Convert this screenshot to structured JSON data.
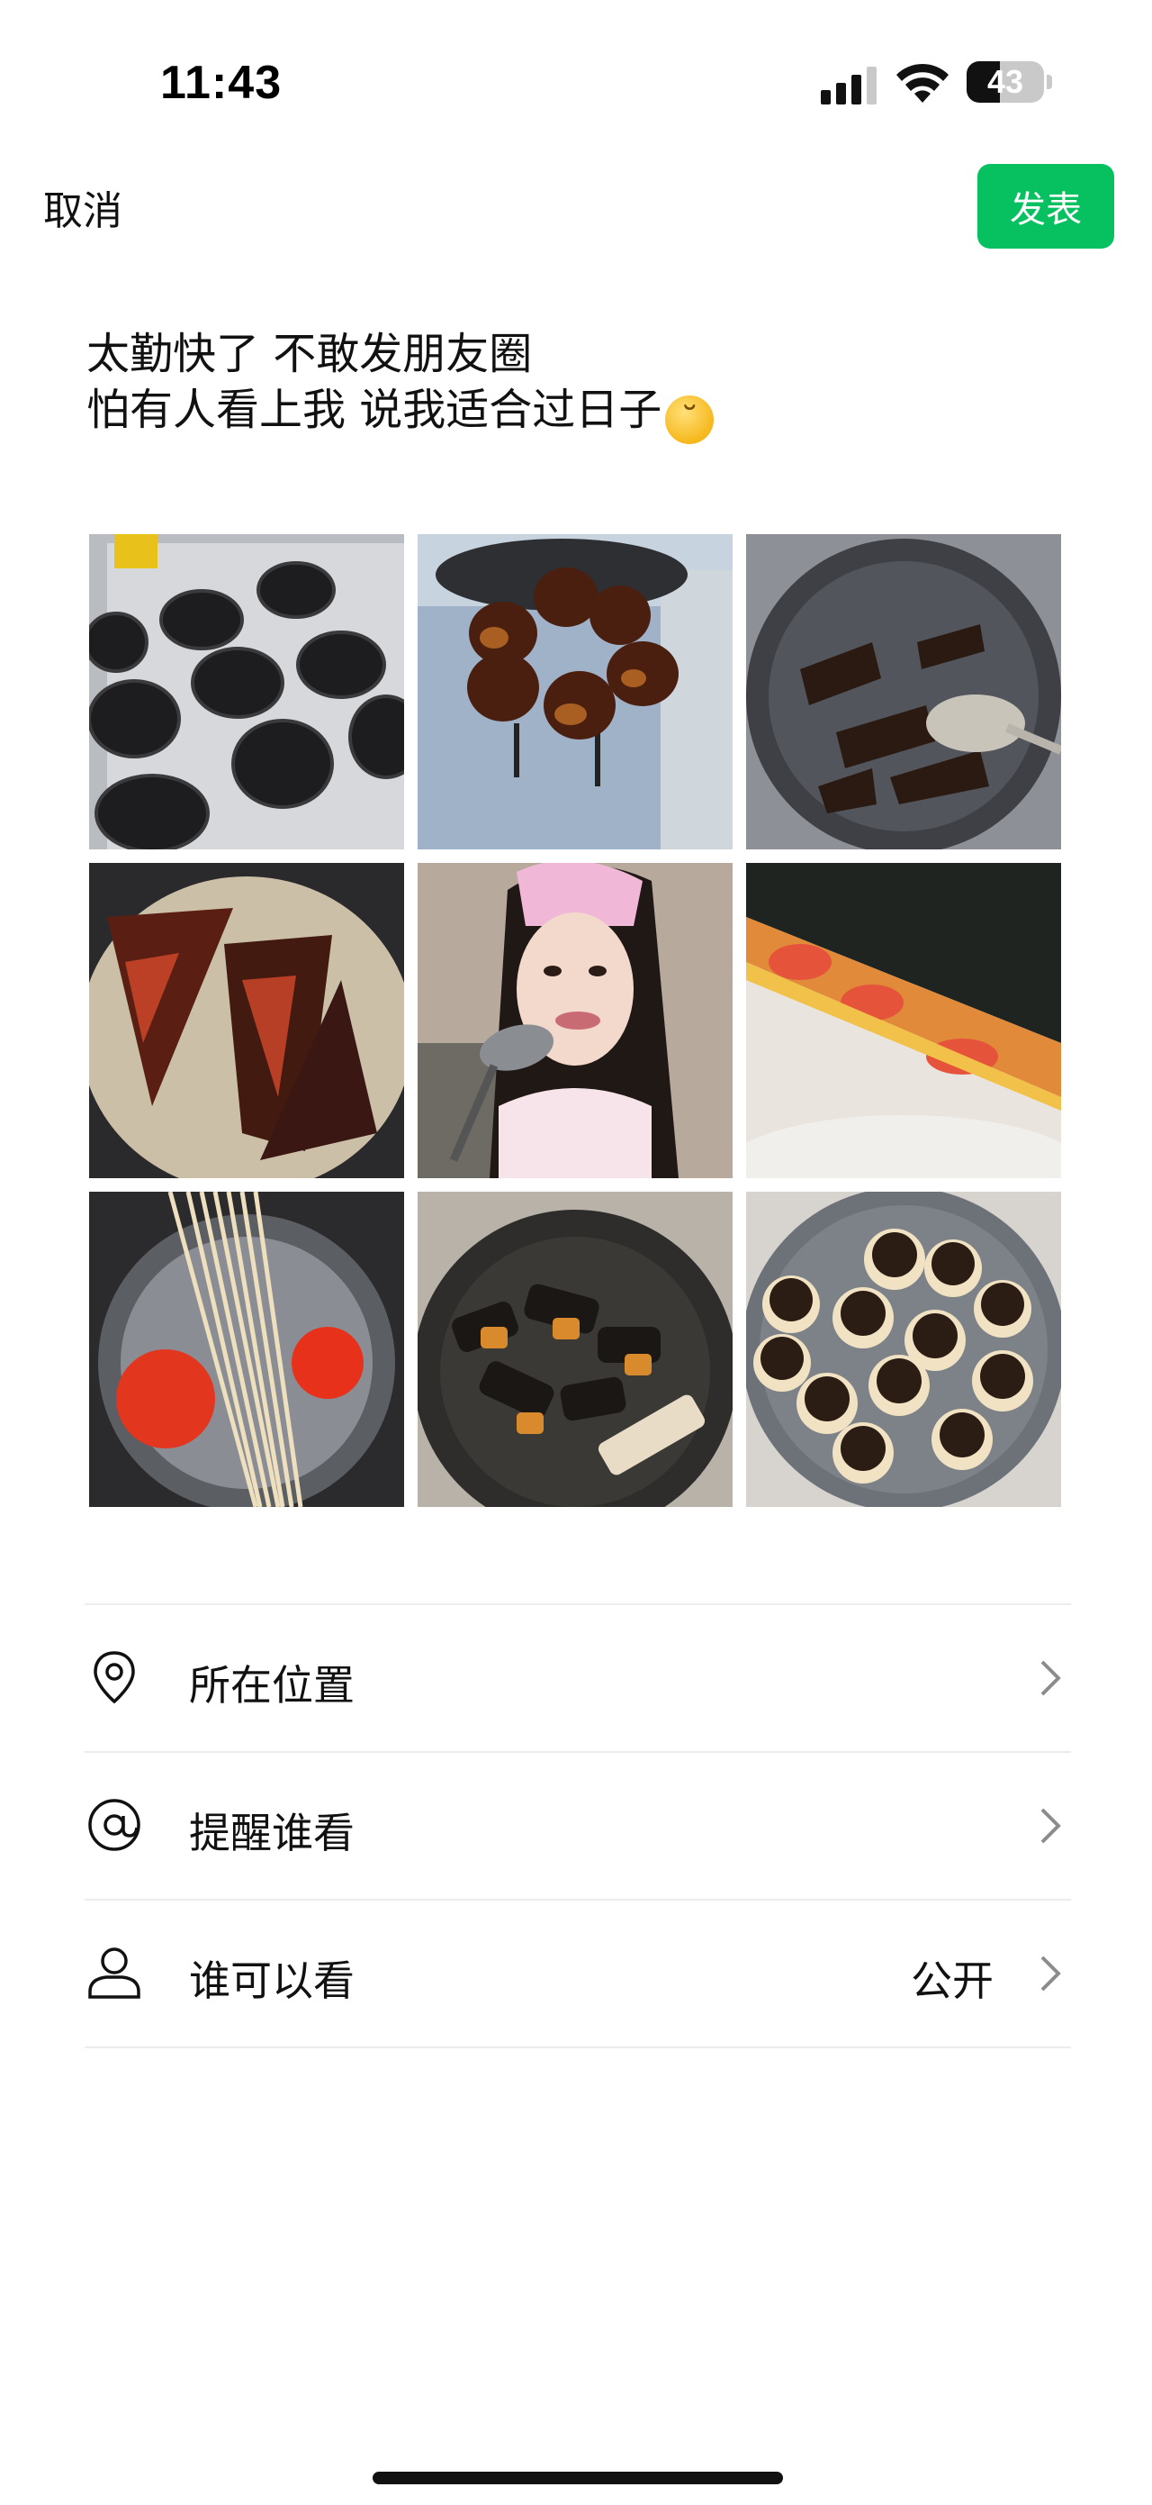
{
  "status_bar": {
    "time": "11:43",
    "battery": "43",
    "battery_level": 0.43
  },
  "nav": {
    "cancel_label": "取消",
    "publish_label": "发表"
  },
  "post": {
    "line1": "太勤快了 不敢发朋友圈",
    "line2": "怕有人看上我 说我适合过日子"
  },
  "photos": [
    "burnt-tart-shells-tray",
    "burnt-buns-on-rack",
    "charred-stir-fry-in-wok",
    "burnt-pancake-slices",
    "selfie-with-spatula",
    "burnt-seaweed-sandwich",
    "noodles-and-tomatoes-boiling",
    "charred-eggplant-in-wok",
    "burnt-round-cakes-in-pan"
  ],
  "options": [
    {
      "label": "所在位置",
      "icon": "location-pin-icon",
      "value": ""
    },
    {
      "label": "提醒谁看",
      "icon": "at-sign-icon",
      "value": ""
    },
    {
      "label": "谁可以看",
      "icon": "person-icon",
      "value": "公开"
    }
  ],
  "colors": {
    "accent": "#07c160",
    "divider": "#ececec",
    "text": "#111111"
  }
}
